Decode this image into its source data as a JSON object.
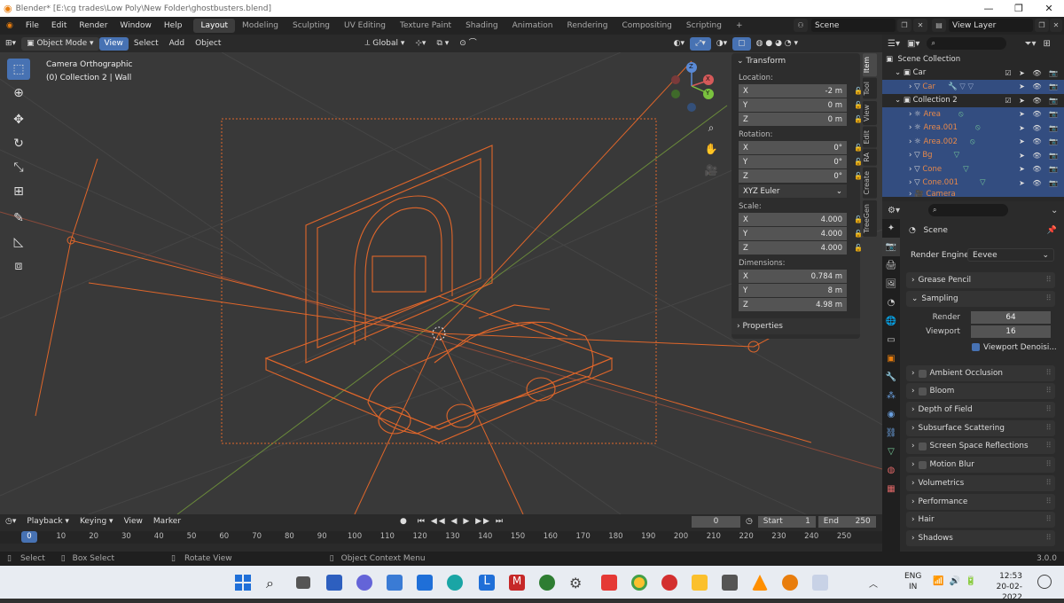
{
  "window": {
    "title": "Blender* [E:\\cg trades\\Low Poly\\New Folder\\ghostbusters.blend]"
  },
  "menu": {
    "items": [
      "File",
      "Edit",
      "Render",
      "Window",
      "Help"
    ],
    "workspaces": [
      "Layout",
      "Modeling",
      "Sculpting",
      "UV Editing",
      "Texture Paint",
      "Shading",
      "Animation",
      "Rendering",
      "Compositing",
      "Scripting"
    ],
    "active_workspace": "Layout",
    "add": "+"
  },
  "scene": {
    "name": "Scene",
    "view_layer": "View Layer"
  },
  "viewport_header": {
    "mode": "Object Mode",
    "view": "View",
    "select": "Select",
    "add": "Add",
    "object": "Object",
    "orientation": "Global"
  },
  "viewport": {
    "view_name": "Camera Orthographic",
    "collection_info": "(0) Collection 2 | Wall"
  },
  "gizmo": {
    "x": "X",
    "y": "Y",
    "z": "Z"
  },
  "transform": {
    "title": "Transform",
    "location_label": "Location:",
    "location": [
      {
        "axis": "X",
        "value": "-2 m"
      },
      {
        "axis": "Y",
        "value": "0 m"
      },
      {
        "axis": "Z",
        "value": "0 m"
      }
    ],
    "rotation_label": "Rotation:",
    "rotation": [
      {
        "axis": "X",
        "value": "0°"
      },
      {
        "axis": "Y",
        "value": "0°"
      },
      {
        "axis": "Z",
        "value": "0°"
      }
    ],
    "rotation_mode": "XYZ Euler",
    "scale_label": "Scale:",
    "scale": [
      {
        "axis": "X",
        "value": "4.000"
      },
      {
        "axis": "Y",
        "value": "4.000"
      },
      {
        "axis": "Z",
        "value": "4.000"
      }
    ],
    "dimensions_label": "Dimensions:",
    "dimensions": [
      {
        "axis": "X",
        "value": "0.784 m"
      },
      {
        "axis": "Y",
        "value": "8 m"
      },
      {
        "axis": "Z",
        "value": "4.98 m"
      }
    ],
    "properties": "Properties"
  },
  "ntabs": [
    "Item",
    "Tool",
    "View",
    "Edit",
    "RA",
    "Create",
    "TreeGen"
  ],
  "outliner": {
    "root": "Scene Collection",
    "rows": [
      {
        "name": "Car",
        "type": "collection"
      },
      {
        "name": "Car",
        "type": "object"
      },
      {
        "name": "Collection 2",
        "type": "collection"
      },
      {
        "name": "Area",
        "type": "light"
      },
      {
        "name": "Area.001",
        "type": "light"
      },
      {
        "name": "Area.002",
        "type": "light"
      },
      {
        "name": "Bg",
        "type": "mesh"
      },
      {
        "name": "Cone",
        "type": "mesh"
      },
      {
        "name": "Cone.001",
        "type": "mesh"
      },
      {
        "name": "Camera",
        "type": "camera"
      }
    ]
  },
  "properties": {
    "scene": "Scene",
    "render_engine_label": "Render Engine",
    "render_engine": "Eevee",
    "sections": [
      {
        "label": "Grease Pencil",
        "open": false,
        "checkbox": false
      },
      {
        "label": "Sampling",
        "open": true,
        "checkbox": false
      },
      {
        "label": "Ambient Occlusion",
        "open": false,
        "checkbox": true
      },
      {
        "label": "Bloom",
        "open": false,
        "checkbox": true
      },
      {
        "label": "Depth of Field",
        "open": false,
        "checkbox": false
      },
      {
        "label": "Subsurface Scattering",
        "open": false,
        "checkbox": false
      },
      {
        "label": "Screen Space Reflections",
        "open": false,
        "checkbox": true
      },
      {
        "label": "Motion Blur",
        "open": false,
        "checkbox": true
      },
      {
        "label": "Volumetrics",
        "open": false,
        "checkbox": false
      },
      {
        "label": "Performance",
        "open": false,
        "checkbox": false
      },
      {
        "label": "Hair",
        "open": false,
        "checkbox": false
      },
      {
        "label": "Shadows",
        "open": false,
        "checkbox": false
      }
    ],
    "sampling": {
      "render_label": "Render",
      "render": "64",
      "viewport_label": "Viewport",
      "viewport": "16",
      "denoise": "Viewport Denoisi..."
    }
  },
  "timeline": {
    "playback": "Playback",
    "keying": "Keying",
    "view": "View",
    "marker": "Marker",
    "current": "0",
    "start_label": "Start",
    "start": "1",
    "end_label": "End",
    "end": "250",
    "ticks": [
      "0",
      "10",
      "20",
      "30",
      "40",
      "50",
      "60",
      "70",
      "80",
      "90",
      "100",
      "110",
      "120",
      "130",
      "140",
      "150",
      "160",
      "170",
      "180",
      "190",
      "200",
      "210",
      "220",
      "230",
      "240",
      "250"
    ]
  },
  "status": {
    "select": "Select",
    "box_select": "Box Select",
    "rotate": "Rotate View",
    "context": "Object Context Menu",
    "version": "3.0.0"
  },
  "taskbar": {
    "lang": "ENG",
    "region": "IN",
    "time": "12:53",
    "date": "20-02-2022"
  },
  "colors": {
    "accent": "#4772b3",
    "wire": "#e0662a",
    "selected_row": "#334d80"
  }
}
